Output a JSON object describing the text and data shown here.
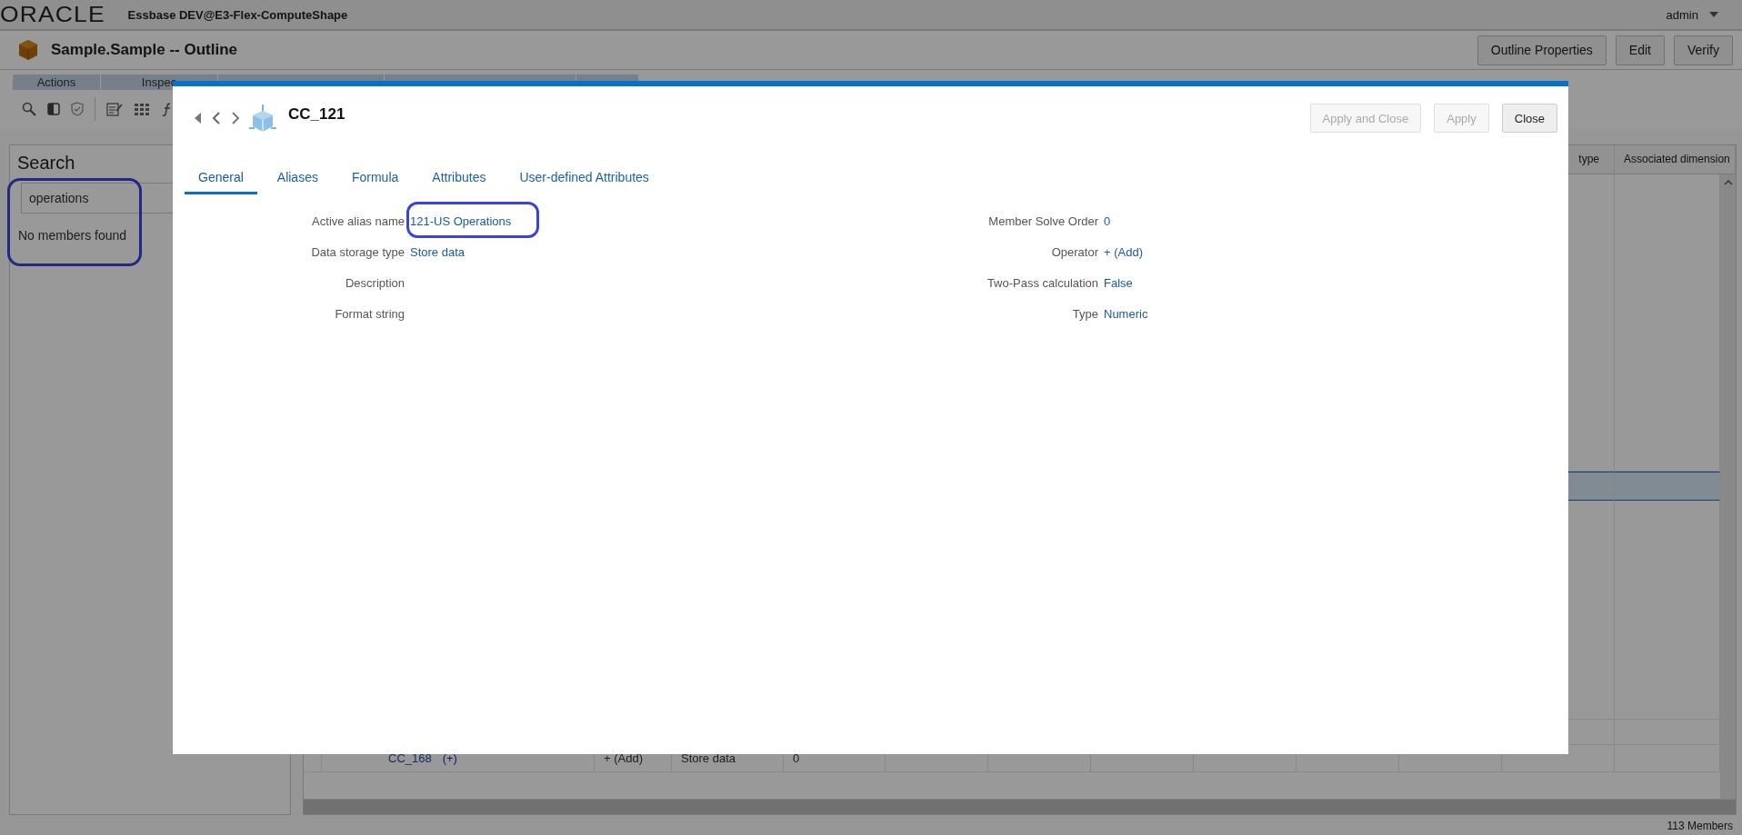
{
  "app": {
    "logo": "ORACLE",
    "title": "Essbase DEV@E3-Flex-ComputeShape",
    "user": "admin"
  },
  "page": {
    "title": "Sample.Sample -- Outline",
    "buttons": [
      "Outline Properties",
      "Edit",
      "Verify"
    ]
  },
  "toolbar": {
    "groups": [
      {
        "label": "Actions"
      },
      {
        "label": "Inspec"
      }
    ]
  },
  "search": {
    "title": "Search",
    "value": "operations",
    "message": "No members found",
    "highlighted": true
  },
  "grid": {
    "columns": [
      {
        "label": "type"
      },
      {
        "label": "Associated dimension"
      }
    ],
    "rows": [
      {
        "selected": true
      },
      {
        "selected": false
      },
      {
        "member": "CC_168",
        "children": "(+)",
        "operator": "+ (Add)",
        "storage": "Store data",
        "column_5": "0",
        "selected": false
      }
    ]
  },
  "status_bar": "113 Members",
  "dialog": {
    "title": "CC_121",
    "buttons": [
      {
        "label": "Apply and Close",
        "disabled": true
      },
      {
        "label": "Apply",
        "disabled": true
      },
      {
        "label": "Close",
        "disabled": false
      }
    ],
    "tabs": [
      {
        "label": "General",
        "selected": true
      },
      {
        "label": "Aliases",
        "selected": false
      },
      {
        "label": "Formula",
        "selected": false
      },
      {
        "label": "Attributes",
        "selected": false
      },
      {
        "label": "User-defined Attributes",
        "selected": false
      }
    ],
    "properties_left": [
      {
        "label": "Active alias name",
        "value": "121-US Operations",
        "highlighted": true
      },
      {
        "label": "Data storage type",
        "value": "Store data",
        "highlighted": false
      },
      {
        "label": "Description",
        "highlighted": false
      },
      {
        "label": "Format string",
        "highlighted": false
      }
    ],
    "properties_right": [
      {
        "label": "Member Solve Order",
        "value": "0"
      },
      {
        "label": "Operator",
        "value": "+ (Add)"
      },
      {
        "label": "Two-Pass calculation",
        "value": "False"
      },
      {
        "label": "Type",
        "value": "Numeric"
      }
    ]
  }
}
